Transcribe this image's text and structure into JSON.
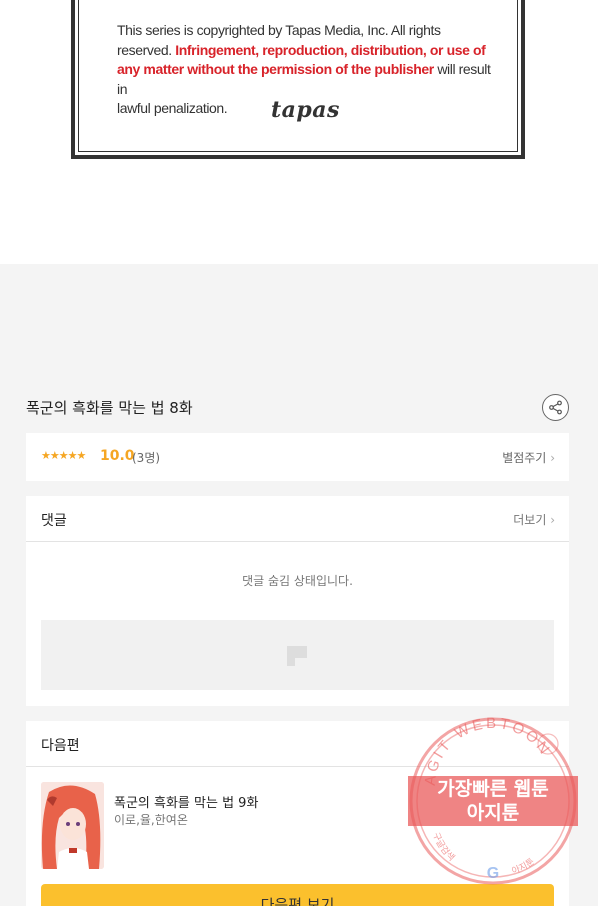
{
  "notice": {
    "line_a": "This series is copyrighted by Tapas Media, Inc. All rights",
    "line_b_plain": "reserved.",
    "line_b_red": "Infringement, reproduction, distribution, or use of",
    "line_c_red": "any matter without the permission of the publisher",
    "line_c_plain": "will result in",
    "line_d": "lawful penalization.",
    "logo": "tapas"
  },
  "episode": {
    "title": "폭군의 흑화를 막는 법 8화"
  },
  "rating": {
    "stars": "★★★★★",
    "score": "10.0",
    "count": "(3명)",
    "rate_label": "별점주기",
    "star_color": "#f5a623"
  },
  "comments": {
    "header": "댓글",
    "more": "더보기",
    "hidden_message": "댓글 숨김 상태입니다."
  },
  "next": {
    "header": "다음편",
    "title": "폭군의 흑화를 막는 법 9화",
    "authors": "이로,율,한여온",
    "button": "다음편 보기",
    "button_color": "#fbc02d"
  },
  "watermark": {
    "arc_top": "AGIT WEBTOON",
    "line1": "가장빠른 웹툰",
    "line2": "아지툰",
    "arc_left": "구글검색",
    "arc_right": "아지툰",
    "g_mark": "G",
    "color": "#e95b5b"
  }
}
